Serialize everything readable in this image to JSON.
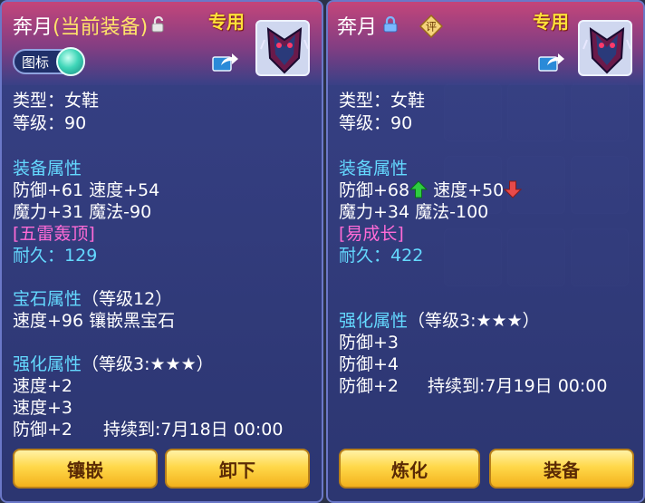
{
  "colors": {
    "title_equipped": "#ffe46a",
    "section": "#64d9ff",
    "special": "#ff6bd6",
    "exclusive": "#ffe13a",
    "up_arrow": "#2ecc40",
    "down_arrow": "#e84a4a"
  },
  "left": {
    "name": "奔月",
    "equipped_tag": "(当前装备)",
    "exclusive": "专用",
    "toggle_label": "图标",
    "lock_icon": "unlock-icon",
    "type": "类型：女鞋",
    "level": "等级：90",
    "section_attr": "装备属性",
    "attr_line1": "防御+61 速度+54",
    "attr_line2": "魔力+31 魔法-90",
    "special": "[五雷轰顶]",
    "durability_label": "耐久：",
    "durability_value": "129",
    "section_gem": "宝石属性",
    "gem_level": "（等级12）",
    "gem_line": "速度+96 镶嵌黑宝石",
    "section_enhance": "强化属性",
    "enhance_level": "（等级3:★★★）",
    "enhance_lines": [
      "速度+2",
      "速度+3",
      "防御+2"
    ],
    "expires": "持续到:7月18日 00:00",
    "btn1": "镶嵌",
    "btn2": "卸下"
  },
  "right": {
    "name": "奔月",
    "exclusive": "专用",
    "lock_icon": "lock-icon",
    "rate_badge": "评",
    "type": "类型：女鞋",
    "level": "等级：90",
    "section_attr": "装备属性",
    "attr_def": "防御+68",
    "attr_spd": "速度+50",
    "attr_line2": "魔力+34 魔法-100",
    "special": "[易成长]",
    "durability_label": "耐久：",
    "durability_value": "422",
    "section_enhance": "强化属性",
    "enhance_level": "（等级3:★★★）",
    "enhance_lines": [
      "防御+3",
      "防御+4",
      "防御+2"
    ],
    "expires": "持续到:7月19日 00:00",
    "btn1": "炼化",
    "btn2": "装备"
  }
}
